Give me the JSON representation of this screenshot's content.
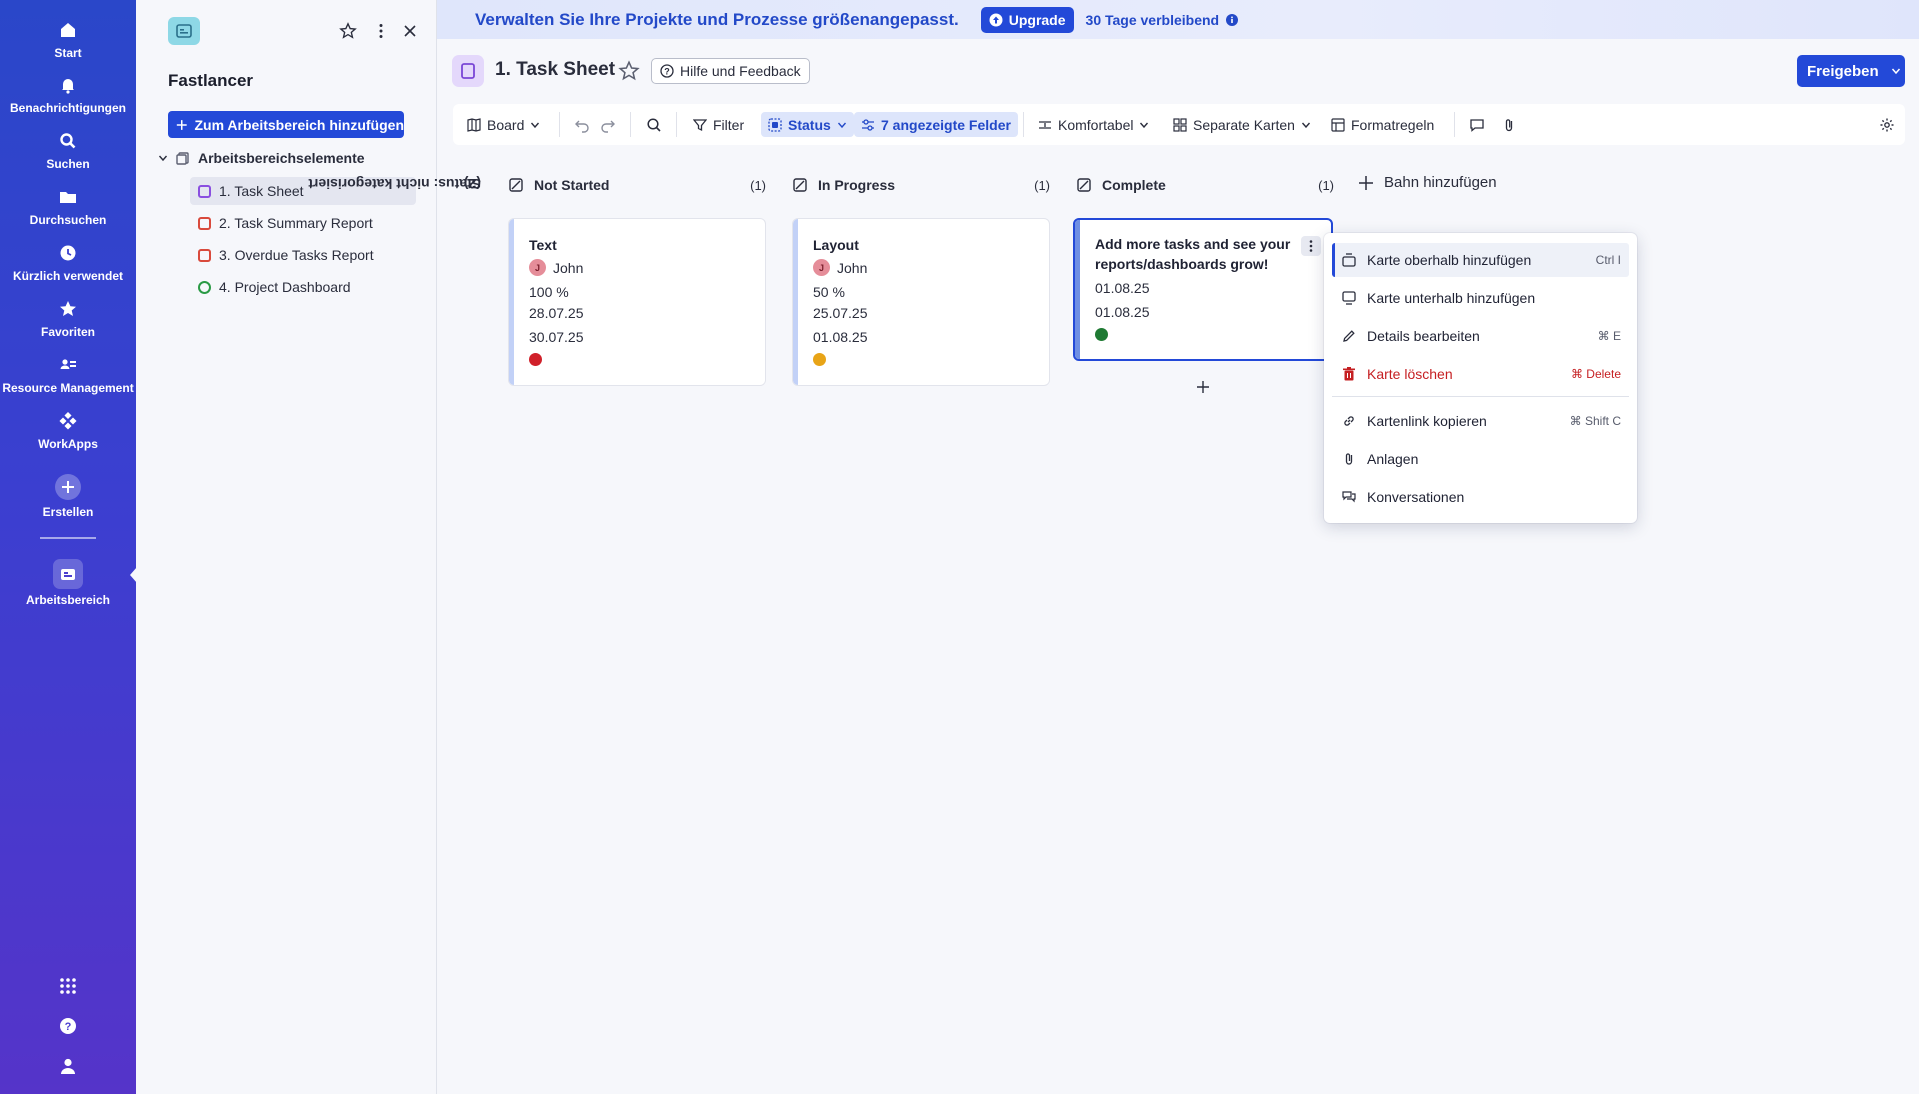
{
  "rail": {
    "items": [
      {
        "label": "Start",
        "icon": "home-icon"
      },
      {
        "label": "Benachrichtigungen",
        "icon": "bell-icon"
      },
      {
        "label": "Suchen",
        "icon": "search-icon"
      },
      {
        "label": "Durchsuchen",
        "icon": "folder-icon"
      },
      {
        "label": "Kürzlich verwendet",
        "icon": "clock-icon"
      },
      {
        "label": "Favoriten",
        "icon": "star-icon"
      },
      {
        "label": "Resource Management",
        "icon": "people-icon"
      },
      {
        "label": "WorkApps",
        "icon": "workapps-icon"
      }
    ],
    "create_label": "Erstellen",
    "workspace_label": "Arbeitsbereich"
  },
  "workspace": {
    "title": "Fastlancer",
    "add_button": "Zum Arbeitsbereich hinzufügen",
    "section": "Arbeitsbereichselemente",
    "items": [
      {
        "label": "1. Task Sheet",
        "active": true
      },
      {
        "label": "2. Task Summary Report"
      },
      {
        "label": "3. Overdue Tasks Report"
      },
      {
        "label": "4. Project Dashboard"
      }
    ]
  },
  "banner": {
    "message": "Verwalten Sie Ihre Projekte und Prozesse größenangepasst.",
    "upgrade": "Upgrade",
    "days_left": "30 Tage verbleibend"
  },
  "sheet": {
    "title": "1. Task Sheet",
    "help": "Hilfe und Feedback",
    "share": "Freigeben"
  },
  "toolbar": {
    "board": "Board",
    "filter": "Filter",
    "status": "Status",
    "fields": "7 angezeigte Felder",
    "comfort": "Komfortabel",
    "cards": "Separate Karten",
    "format": "Formatregeln"
  },
  "board": {
    "swimlane_label": "Status: nicht kategorisiert",
    "swimlane_count": "(2)",
    "add_lane": "Bahn hinzufügen",
    "columns": [
      {
        "name": "Not Started",
        "count": "(1)"
      },
      {
        "name": "In Progress",
        "count": "(1)"
      },
      {
        "name": "Complete",
        "count": "(1)"
      }
    ],
    "cards": [
      {
        "title": "Text",
        "assignee": "John",
        "initial": "J",
        "percent": "100 %",
        "start": "28.07.25",
        "end": "30.07.25",
        "status_color": "#d0202a"
      },
      {
        "title": "Layout",
        "assignee": "John",
        "initial": "J",
        "percent": "50 %",
        "start": "25.07.25",
        "end": "01.08.25",
        "status_color": "#e8a417"
      },
      {
        "title": "Add more tasks and see your reports/dashboards grow!",
        "start": "01.08.25",
        "end": "01.08.25",
        "status_color": "#1f7a33"
      }
    ]
  },
  "menu": {
    "items": [
      {
        "label": "Karte oberhalb hinzufügen",
        "shortcut": "Ctrl I",
        "icon": "insert-above-icon"
      },
      {
        "label": "Karte unterhalb hinzufügen",
        "shortcut": "",
        "icon": "insert-below-icon"
      },
      {
        "label": "Details bearbeiten",
        "shortcut": "⌘ E",
        "icon": "pencil-icon"
      },
      {
        "label": "Karte löschen",
        "shortcut": "⌘ Delete",
        "icon": "trash-icon"
      },
      {
        "label": "Kartenlink kopieren",
        "shortcut": "⌘ Shift C",
        "icon": "link-icon"
      },
      {
        "label": "Anlagen",
        "shortcut": "",
        "icon": "paperclip-icon"
      },
      {
        "label": "Konversationen",
        "shortcut": "",
        "icon": "conversation-icon"
      }
    ]
  },
  "colors": {
    "accent": "#2349d8",
    "danger": "#c51f22"
  }
}
